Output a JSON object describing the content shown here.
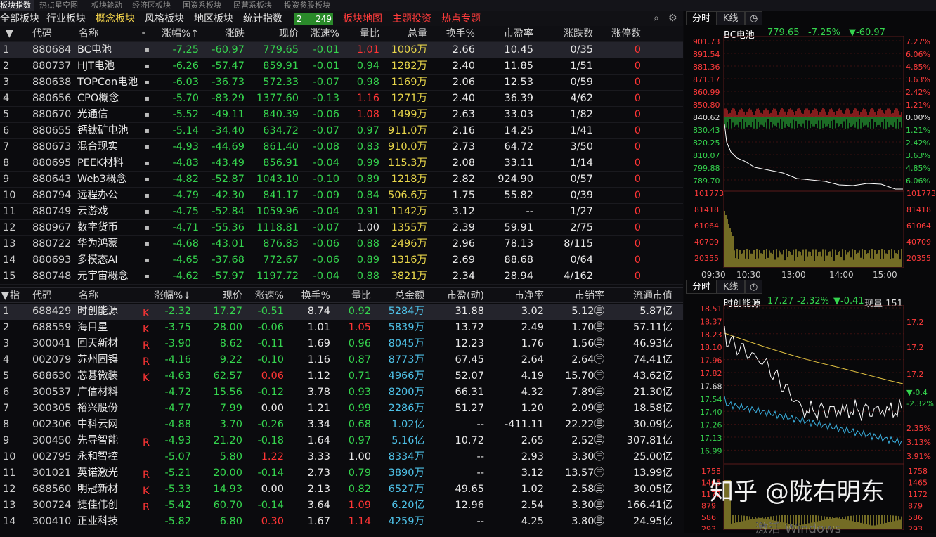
{
  "top_tabs": [
    "板块指数",
    "热点星空图",
    "板块轮动",
    "经济区板块",
    "国资系板块",
    "民营系板块",
    "投资参股板块"
  ],
  "sector_tabs": {
    "all": "全部板块",
    "industry": "行业板块",
    "concept": "概念板块",
    "style": "风格板块",
    "region": "地区板块",
    "stats": "统计指数",
    "badge_left": "2",
    "badge_right": "249",
    "map": "板块地图",
    "theme": "主题投资",
    "hot": "热点专题"
  },
  "sector_header": [
    "代码",
    "名称",
    "涨幅%↑",
    "涨跌",
    "现价",
    "涨速%",
    "量比",
    "总量",
    "换手%",
    "市盈率",
    "涨跌数",
    "涨停数"
  ],
  "sectors": [
    {
      "i": "1",
      "code": "880684",
      "name": "BC电池",
      "chg": "-7.25",
      "diff": "-60.97",
      "price": "779.65",
      "speed": "-0.01",
      "vr": "1.01",
      "vol": "1006万",
      "turn": "2.66",
      "pe": "10.45",
      "ud": "0/35",
      "lu": "0"
    },
    {
      "i": "2",
      "code": "880737",
      "name": "HJT电池",
      "chg": "-6.26",
      "diff": "-57.47",
      "price": "859.91",
      "speed": "-0.01",
      "vr": "0.94",
      "vol": "1282万",
      "turn": "2.40",
      "pe": "11.85",
      "ud": "1/51",
      "lu": "0"
    },
    {
      "i": "3",
      "code": "880638",
      "name": "TOPCon电池",
      "chg": "-6.03",
      "diff": "-36.73",
      "price": "572.33",
      "speed": "-0.07",
      "vr": "0.98",
      "vol": "1169万",
      "turn": "2.06",
      "pe": "12.53",
      "ud": "0/59",
      "lu": "0"
    },
    {
      "i": "4",
      "code": "880656",
      "name": "CPO概念",
      "chg": "-5.70",
      "diff": "-83.29",
      "price": "1377.60",
      "speed": "-0.13",
      "vr": "1.16",
      "vol": "1271万",
      "turn": "2.40",
      "pe": "36.39",
      "ud": "4/62",
      "lu": "0"
    },
    {
      "i": "5",
      "code": "880670",
      "name": "光通信",
      "chg": "-5.52",
      "diff": "-49.11",
      "price": "840.39",
      "speed": "-0.06",
      "vr": "1.08",
      "vol": "1499万",
      "turn": "2.63",
      "pe": "33.03",
      "ud": "1/82",
      "lu": "0"
    },
    {
      "i": "6",
      "code": "880655",
      "name": "钙钛矿电池",
      "chg": "-5.14",
      "diff": "-34.40",
      "price": "634.72",
      "speed": "-0.07",
      "vr": "0.97",
      "vol": "911.0万",
      "turn": "2.16",
      "pe": "14.25",
      "ud": "1/41",
      "lu": "0"
    },
    {
      "i": "7",
      "code": "880673",
      "name": "混合现实",
      "chg": "-4.93",
      "diff": "-44.69",
      "price": "861.40",
      "speed": "-0.08",
      "vr": "0.83",
      "vol": "910.0万",
      "turn": "2.73",
      "pe": "64.72",
      "ud": "3/50",
      "lu": "0"
    },
    {
      "i": "8",
      "code": "880695",
      "name": "PEEK材料",
      "chg": "-4.83",
      "diff": "-43.49",
      "price": "856.91",
      "speed": "-0.04",
      "vr": "0.99",
      "vol": "115.3万",
      "turn": "2.08",
      "pe": "33.11",
      "ud": "1/14",
      "lu": "0"
    },
    {
      "i": "9",
      "code": "880643",
      "name": "Web3概念",
      "chg": "-4.82",
      "diff": "-52.87",
      "price": "1043.10",
      "speed": "-0.10",
      "vr": "0.89",
      "vol": "1218万",
      "turn": "2.82",
      "pe": "924.90",
      "ud": "0/57",
      "lu": "0"
    },
    {
      "i": "10",
      "code": "880794",
      "name": "远程办公",
      "chg": "-4.79",
      "diff": "-42.30",
      "price": "841.17",
      "speed": "-0.09",
      "vr": "0.84",
      "vol": "506.6万",
      "turn": "1.75",
      "pe": "55.82",
      "ud": "0/39",
      "lu": "0"
    },
    {
      "i": "11",
      "code": "880749",
      "name": "云游戏",
      "chg": "-4.75",
      "diff": "-52.84",
      "price": "1059.96",
      "speed": "-0.04",
      "vr": "0.91",
      "vol": "1142万",
      "turn": "3.12",
      "pe": "--",
      "ud": "1/27",
      "lu": "0"
    },
    {
      "i": "12",
      "code": "880967",
      "name": "数字货币",
      "chg": "-4.71",
      "diff": "-55.36",
      "price": "1118.81",
      "speed": "-0.07",
      "vr": "1.00",
      "vol": "1355万",
      "turn": "2.39",
      "pe": "59.91",
      "ud": "2/75",
      "lu": "0"
    },
    {
      "i": "13",
      "code": "880722",
      "name": "华为鸿蒙",
      "chg": "-4.68",
      "diff": "-43.01",
      "price": "876.83",
      "speed": "-0.06",
      "vr": "0.88",
      "vol": "2496万",
      "turn": "2.96",
      "pe": "78.13",
      "ud": "8/115",
      "lu": "0"
    },
    {
      "i": "14",
      "code": "880693",
      "name": "多模态AI",
      "chg": "-4.65",
      "diff": "-37.68",
      "price": "772.67",
      "speed": "-0.06",
      "vr": "0.89",
      "vol": "1316万",
      "turn": "2.69",
      "pe": "88.68",
      "ud": "0/64",
      "lu": "0"
    },
    {
      "i": "15",
      "code": "880748",
      "name": "元宇宙概念",
      "chg": "-4.62",
      "diff": "-57.97",
      "price": "1197.72",
      "speed": "-0.04",
      "vr": "0.88",
      "vol": "3821万",
      "turn": "2.34",
      "pe": "28.94",
      "ud": "4/162",
      "lu": "0"
    }
  ],
  "stock_header": [
    "指",
    "代码",
    "名称",
    "涨幅%↓",
    "现价",
    "涨速%",
    "换手%",
    "量比",
    "总金额",
    "市盈(动)",
    "市净率",
    "市销率",
    "流通市值"
  ],
  "stocks": [
    {
      "i": "1",
      "code": "688429",
      "name": "时创能源",
      "mk": "K",
      "chg": "-2.32",
      "price": "17.27",
      "speed": "-0.51",
      "turn": "8.74",
      "vr": "0.92",
      "amt": "5284万",
      "pe": "31.88",
      "pb": "3.02",
      "ps": "5.12㊂",
      "cap": "5.87亿"
    },
    {
      "i": "2",
      "code": "688559",
      "name": "海目星",
      "mk": "K",
      "chg": "-3.75",
      "price": "28.00",
      "speed": "-0.06",
      "turn": "1.01",
      "vr": "1.05",
      "amt": "5839万",
      "pe": "13.72",
      "pb": "2.49",
      "ps": "1.70㊂",
      "cap": "57.11亿"
    },
    {
      "i": "3",
      "code": "300041",
      "name": "回天新材",
      "mk": "R",
      "chg": "-3.90",
      "price": "8.62",
      "speed": "-0.11",
      "turn": "1.69",
      "vr": "0.96",
      "amt": "8045万",
      "pe": "12.23",
      "pb": "1.76",
      "ps": "1.56㊂",
      "cap": "46.93亿"
    },
    {
      "i": "4",
      "code": "002079",
      "name": "苏州固锝",
      "mk": "R",
      "chg": "-4.16",
      "price": "9.22",
      "speed": "-0.10",
      "turn": "1.16",
      "vr": "0.87",
      "amt": "8773万",
      "pe": "67.45",
      "pb": "2.64",
      "ps": "2.64㊂",
      "cap": "74.41亿"
    },
    {
      "i": "5",
      "code": "688630",
      "name": "芯碁微装",
      "mk": "K",
      "chg": "-4.63",
      "price": "62.57",
      "speed": "0.06",
      "turn": "1.12",
      "vr": "0.71",
      "amt": "4966万",
      "pe": "52.07",
      "pb": "4.19",
      "ps": "15.70㊂",
      "cap": "43.62亿"
    },
    {
      "i": "6",
      "code": "300537",
      "name": "广信材料",
      "mk": "",
      "chg": "-4.72",
      "price": "15.56",
      "speed": "-0.12",
      "turn": "3.78",
      "vr": "0.93",
      "amt": "8200万",
      "pe": "66.31",
      "pb": "4.32",
      "ps": "7.89㊂",
      "cap": "21.30亿"
    },
    {
      "i": "7",
      "code": "300305",
      "name": "裕兴股份",
      "mk": "",
      "chg": "-4.77",
      "price": "7.99",
      "speed": "0.00",
      "turn": "1.21",
      "vr": "0.99",
      "amt": "2286万",
      "pe": "51.27",
      "pb": "1.20",
      "ps": "2.09㊂",
      "cap": "18.58亿"
    },
    {
      "i": "8",
      "code": "002306",
      "name": "中科云网",
      "mk": "",
      "chg": "-4.88",
      "price": "3.70",
      "speed": "-0.26",
      "turn": "3.34",
      "vr": "0.68",
      "amt": "1.02亿",
      "pe": "--",
      "pb": "-411.11",
      "ps": "22.22㊂",
      "cap": "30.09亿"
    },
    {
      "i": "9",
      "code": "300450",
      "name": "先导智能",
      "mk": "R",
      "chg": "-4.93",
      "price": "21.20",
      "speed": "-0.18",
      "turn": "1.64",
      "vr": "0.97",
      "amt": "5.16亿",
      "pe": "10.72",
      "pb": "2.65",
      "ps": "2.52㊂",
      "cap": "307.81亿"
    },
    {
      "i": "10",
      "code": "002795",
      "name": "永和智控",
      "mk": "",
      "chg": "-5.07",
      "price": "5.80",
      "speed": "1.22",
      "turn": "3.33",
      "vr": "1.00",
      "amt": "8334万",
      "pe": "--",
      "pb": "2.93",
      "ps": "3.30㊂",
      "cap": "25.00亿"
    },
    {
      "i": "11",
      "code": "301021",
      "name": "英诺激光",
      "mk": "R",
      "chg": "-5.21",
      "price": "20.00",
      "speed": "-0.14",
      "turn": "2.73",
      "vr": "0.79",
      "amt": "3890万",
      "pe": "--",
      "pb": "3.12",
      "ps": "13.57㊂",
      "cap": "13.99亿"
    },
    {
      "i": "12",
      "code": "688560",
      "name": "明冠新材",
      "mk": "K",
      "chg": "-5.33",
      "price": "14.93",
      "speed": "0.00",
      "turn": "2.13",
      "vr": "0.82",
      "amt": "6527万",
      "pe": "49.65",
      "pb": "1.02",
      "ps": "2.58㊂",
      "cap": "30.05亿"
    },
    {
      "i": "13",
      "code": "300724",
      "name": "捷佳伟创",
      "mk": "R",
      "chg": "-5.42",
      "price": "60.70",
      "speed": "-0.14",
      "turn": "3.64",
      "vr": "1.09",
      "amt": "6.20亿",
      "pe": "12.96",
      "pb": "2.54",
      "ps": "3.30㊂",
      "cap": "166.41亿"
    },
    {
      "i": "14",
      "code": "300410",
      "name": "正业科技",
      "mk": "",
      "chg": "-5.82",
      "price": "6.80",
      "speed": "0.30",
      "turn": "1.67",
      "vr": "1.14",
      "amt": "4259万",
      "pe": "--",
      "pb": "4.25",
      "ps": "3.80㊂",
      "cap": "24.95亿"
    }
  ],
  "panel1": {
    "tab_time": "分时",
    "tab_k": "K线",
    "name": "BC电池",
    "price": "779.65",
    "pct": "-7.25%",
    "diff": "▼-60.97",
    "left_labels": [
      "901.73",
      "891.54",
      "881.36",
      "871.17",
      "860.99",
      "850.80",
      "840.62",
      "830.43",
      "820.25",
      "810.07",
      "799.88",
      "789.70",
      "101773",
      "81418",
      "61064",
      "40709",
      "20355"
    ],
    "right_labels": [
      "7.27%",
      "6.06%",
      "4.85%",
      "3.63%",
      "2.42%",
      "1.21%",
      "0.00%",
      "1.21%",
      "2.42%",
      "3.63%",
      "4.85%",
      "6.06%",
      "101773",
      "81418",
      "61064",
      "40709",
      "20355"
    ],
    "time_labels": [
      "09:30",
      "10:30",
      "13:00",
      "14:00",
      "15:00"
    ]
  },
  "panel2": {
    "tab_time": "分时",
    "tab_k": "K线",
    "name": "时创能源",
    "price": "17.27",
    "pct": "-2.32%",
    "diff": "▼-0.41",
    "extra": "现量 151",
    "left_labels": [
      "18.51",
      "18.37",
      "18.23",
      "18.10",
      "17.96",
      "17.82",
      "17.68",
      "17.54",
      "17.40",
      "17.26",
      "17.13",
      "16.99",
      "1758",
      "1465",
      "1172",
      "879",
      "586",
      "293"
    ],
    "right_labels": [
      "17.2",
      "17.2",
      "17.2",
      "▼-0.4",
      "-2.32%",
      "2.35%",
      "3.13%",
      "3.91%",
      "1758",
      "1465",
      "1172",
      "879",
      "586",
      "293"
    ]
  },
  "watermark": "知乎 @陇右明东",
  "activate": "激活 Windows"
}
